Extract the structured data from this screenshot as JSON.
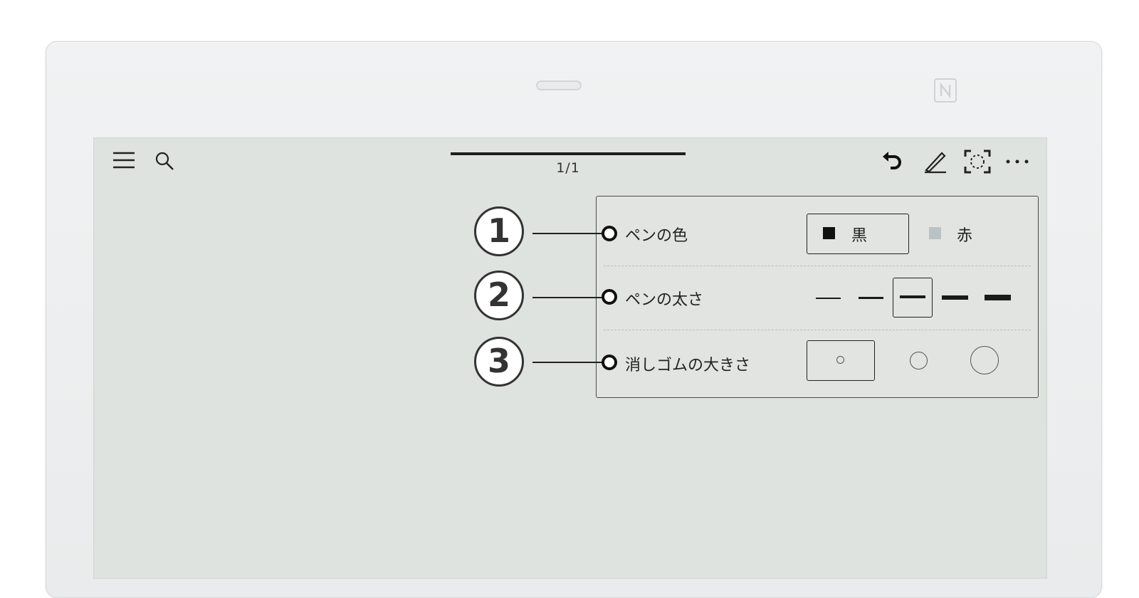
{
  "toolbar": {
    "page_indicator": "1/1",
    "icons": [
      "menu-icon",
      "search-icon",
      "undo-icon",
      "pen-icon",
      "capture-icon",
      "more-icon"
    ]
  },
  "device": {
    "icons": [
      "nfc-icon"
    ]
  },
  "pen_settings": {
    "pen_color": {
      "label": "ペンの色",
      "options": [
        "黒",
        "赤"
      ],
      "selected": "黒"
    },
    "pen_width": {
      "label": "ペンの太さ",
      "options_count": 5,
      "selected_index": 2
    },
    "eraser_size": {
      "label": "消しゴムの大きさ",
      "options_count": 3,
      "selected_index": 0
    }
  },
  "callouts": [
    "1",
    "2",
    "3"
  ],
  "colors": {
    "screen": "#dfe3e0",
    "ink": "#1a1a1a",
    "red_swatch": "#b9c3c4"
  }
}
